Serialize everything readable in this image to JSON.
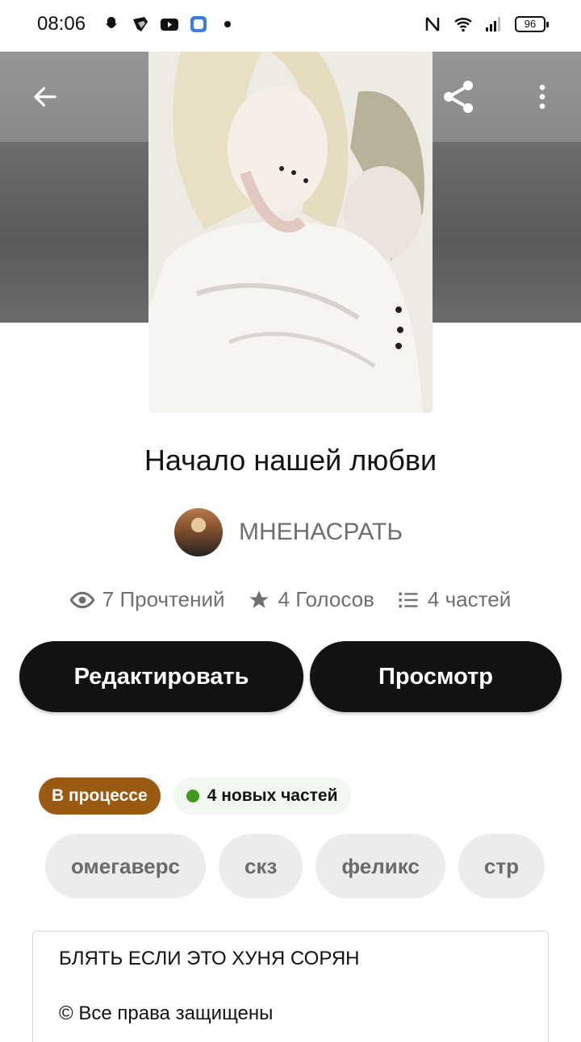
{
  "status_bar": {
    "time": "08:06",
    "battery": "96",
    "left_icons": [
      "snapchat-icon",
      "shield-app-icon",
      "youtube-icon",
      "app-square-icon",
      "notification-dot-icon"
    ],
    "right_icons": [
      "nfc-icon",
      "wifi-icon",
      "signal-icon"
    ]
  },
  "header": {
    "back_icon": "arrow-left-icon",
    "share_icon": "share-icon",
    "more_icon": "more-vertical-icon"
  },
  "story": {
    "title": "Начало нашей любви",
    "author": "МНЕНАСРАТЬ",
    "stats": {
      "reads": "7 Прочтений",
      "votes": "4 Голосов",
      "parts": "4 частей"
    }
  },
  "actions": {
    "edit_label": "Редактировать",
    "view_label": "Просмотр"
  },
  "badges": {
    "status": "В процессе",
    "new_parts": "4 новых частей"
  },
  "tags": [
    "омегаверс",
    "скз",
    "феликс",
    "стр"
  ],
  "description": {
    "text": "БЛЯТЬ ЕСЛИ ЭТО ХУНЯ СОРЯН",
    "copyright": "© Все права защищены"
  },
  "colors": {
    "button_bg": "#121212",
    "status_badge": "#9a5a12",
    "new_dot": "#3e9b1f"
  }
}
